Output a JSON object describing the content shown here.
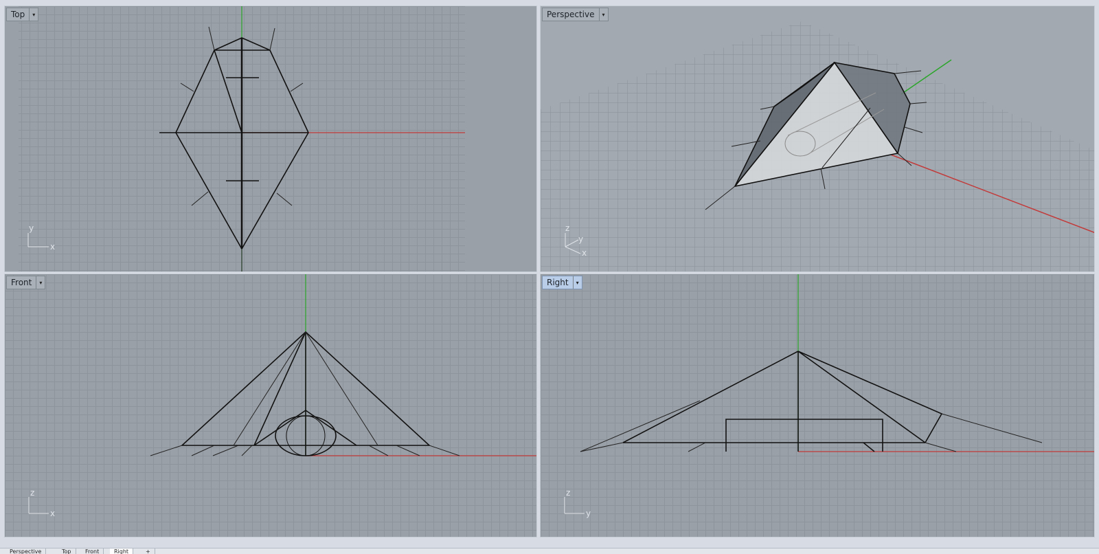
{
  "viewports": {
    "top": {
      "label": "Top"
    },
    "perspective": {
      "label": "Perspective"
    },
    "front": {
      "label": "Front"
    },
    "right": {
      "label": "Right"
    }
  },
  "axis_labels": {
    "top": {
      "v": "y",
      "h": "x"
    },
    "perspective": {
      "z": "z",
      "y": "y",
      "x": "x"
    },
    "front": {
      "v": "z",
      "h": "x"
    },
    "right": {
      "v": "z",
      "h": "y"
    }
  },
  "dropdown_glyph": "▾",
  "bottom_tabs": [
    "Perspective",
    "Top",
    "Front",
    "Right",
    "+"
  ],
  "colors": {
    "grid_bg": "#9aa0a7",
    "x_axis": "#c23a3a",
    "y_axis": "#2aa62a",
    "active_label": "#b9cde8"
  }
}
